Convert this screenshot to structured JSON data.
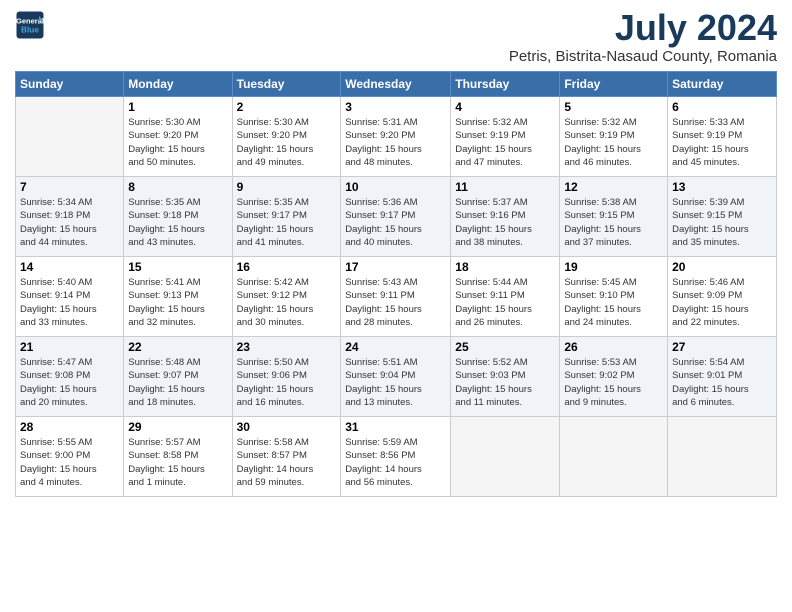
{
  "header": {
    "logo_line1": "General",
    "logo_line2": "Blue",
    "month_title": "July 2024",
    "location": "Petris, Bistrita-Nasaud County, Romania"
  },
  "days_of_week": [
    "Sunday",
    "Monday",
    "Tuesday",
    "Wednesday",
    "Thursday",
    "Friday",
    "Saturday"
  ],
  "weeks": [
    [
      {
        "day": "",
        "info": ""
      },
      {
        "day": "1",
        "info": "Sunrise: 5:30 AM\nSunset: 9:20 PM\nDaylight: 15 hours\nand 50 minutes."
      },
      {
        "day": "2",
        "info": "Sunrise: 5:30 AM\nSunset: 9:20 PM\nDaylight: 15 hours\nand 49 minutes."
      },
      {
        "day": "3",
        "info": "Sunrise: 5:31 AM\nSunset: 9:20 PM\nDaylight: 15 hours\nand 48 minutes."
      },
      {
        "day": "4",
        "info": "Sunrise: 5:32 AM\nSunset: 9:19 PM\nDaylight: 15 hours\nand 47 minutes."
      },
      {
        "day": "5",
        "info": "Sunrise: 5:32 AM\nSunset: 9:19 PM\nDaylight: 15 hours\nand 46 minutes."
      },
      {
        "day": "6",
        "info": "Sunrise: 5:33 AM\nSunset: 9:19 PM\nDaylight: 15 hours\nand 45 minutes."
      }
    ],
    [
      {
        "day": "7",
        "info": "Sunrise: 5:34 AM\nSunset: 9:18 PM\nDaylight: 15 hours\nand 44 minutes."
      },
      {
        "day": "8",
        "info": "Sunrise: 5:35 AM\nSunset: 9:18 PM\nDaylight: 15 hours\nand 43 minutes."
      },
      {
        "day": "9",
        "info": "Sunrise: 5:35 AM\nSunset: 9:17 PM\nDaylight: 15 hours\nand 41 minutes."
      },
      {
        "day": "10",
        "info": "Sunrise: 5:36 AM\nSunset: 9:17 PM\nDaylight: 15 hours\nand 40 minutes."
      },
      {
        "day": "11",
        "info": "Sunrise: 5:37 AM\nSunset: 9:16 PM\nDaylight: 15 hours\nand 38 minutes."
      },
      {
        "day": "12",
        "info": "Sunrise: 5:38 AM\nSunset: 9:15 PM\nDaylight: 15 hours\nand 37 minutes."
      },
      {
        "day": "13",
        "info": "Sunrise: 5:39 AM\nSunset: 9:15 PM\nDaylight: 15 hours\nand 35 minutes."
      }
    ],
    [
      {
        "day": "14",
        "info": "Sunrise: 5:40 AM\nSunset: 9:14 PM\nDaylight: 15 hours\nand 33 minutes."
      },
      {
        "day": "15",
        "info": "Sunrise: 5:41 AM\nSunset: 9:13 PM\nDaylight: 15 hours\nand 32 minutes."
      },
      {
        "day": "16",
        "info": "Sunrise: 5:42 AM\nSunset: 9:12 PM\nDaylight: 15 hours\nand 30 minutes."
      },
      {
        "day": "17",
        "info": "Sunrise: 5:43 AM\nSunset: 9:11 PM\nDaylight: 15 hours\nand 28 minutes."
      },
      {
        "day": "18",
        "info": "Sunrise: 5:44 AM\nSunset: 9:11 PM\nDaylight: 15 hours\nand 26 minutes."
      },
      {
        "day": "19",
        "info": "Sunrise: 5:45 AM\nSunset: 9:10 PM\nDaylight: 15 hours\nand 24 minutes."
      },
      {
        "day": "20",
        "info": "Sunrise: 5:46 AM\nSunset: 9:09 PM\nDaylight: 15 hours\nand 22 minutes."
      }
    ],
    [
      {
        "day": "21",
        "info": "Sunrise: 5:47 AM\nSunset: 9:08 PM\nDaylight: 15 hours\nand 20 minutes."
      },
      {
        "day": "22",
        "info": "Sunrise: 5:48 AM\nSunset: 9:07 PM\nDaylight: 15 hours\nand 18 minutes."
      },
      {
        "day": "23",
        "info": "Sunrise: 5:50 AM\nSunset: 9:06 PM\nDaylight: 15 hours\nand 16 minutes."
      },
      {
        "day": "24",
        "info": "Sunrise: 5:51 AM\nSunset: 9:04 PM\nDaylight: 15 hours\nand 13 minutes."
      },
      {
        "day": "25",
        "info": "Sunrise: 5:52 AM\nSunset: 9:03 PM\nDaylight: 15 hours\nand 11 minutes."
      },
      {
        "day": "26",
        "info": "Sunrise: 5:53 AM\nSunset: 9:02 PM\nDaylight: 15 hours\nand 9 minutes."
      },
      {
        "day": "27",
        "info": "Sunrise: 5:54 AM\nSunset: 9:01 PM\nDaylight: 15 hours\nand 6 minutes."
      }
    ],
    [
      {
        "day": "28",
        "info": "Sunrise: 5:55 AM\nSunset: 9:00 PM\nDaylight: 15 hours\nand 4 minutes."
      },
      {
        "day": "29",
        "info": "Sunrise: 5:57 AM\nSunset: 8:58 PM\nDaylight: 15 hours\nand 1 minute."
      },
      {
        "day": "30",
        "info": "Sunrise: 5:58 AM\nSunset: 8:57 PM\nDaylight: 14 hours\nand 59 minutes."
      },
      {
        "day": "31",
        "info": "Sunrise: 5:59 AM\nSunset: 8:56 PM\nDaylight: 14 hours\nand 56 minutes."
      },
      {
        "day": "",
        "info": ""
      },
      {
        "day": "",
        "info": ""
      },
      {
        "day": "",
        "info": ""
      }
    ]
  ]
}
